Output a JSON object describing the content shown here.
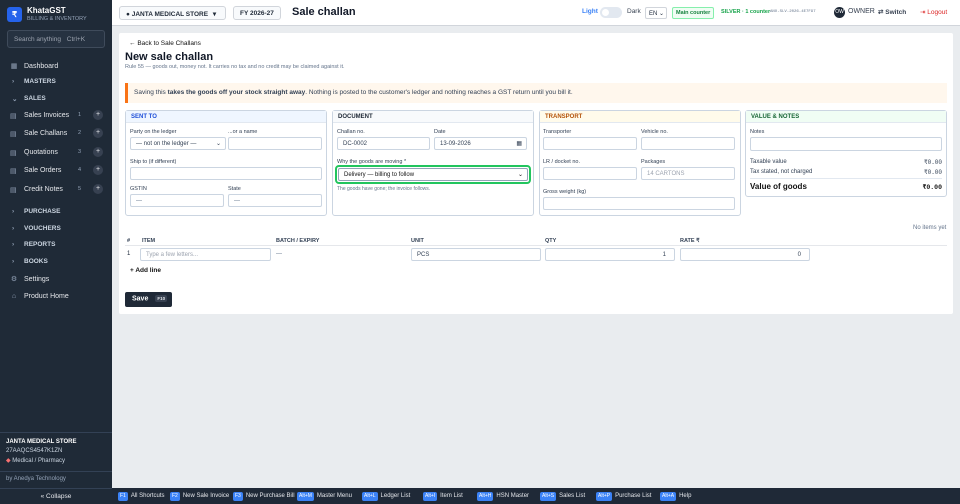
{
  "app": {
    "logo_glyph": "₹",
    "name": "KhataGST",
    "tagline": "BILLING & INVENTORY"
  },
  "search": {
    "label": "Search anything",
    "shortcut": "Ctrl+K"
  },
  "sidebar": {
    "dashboard": "Dashboard",
    "masters": "MASTERS",
    "sales": "SALES",
    "sales_items": [
      {
        "label": "Sales Invoices",
        "count": "1"
      },
      {
        "label": "Sale Challans",
        "count": "2"
      },
      {
        "label": "Quotations",
        "count": "3"
      },
      {
        "label": "Sale Orders",
        "count": "4"
      },
      {
        "label": "Credit Notes",
        "count": "5"
      }
    ],
    "purchase": "PURCHASE",
    "vouchers": "VOUCHERS",
    "reports": "REPORTS",
    "books": "BOOKS",
    "settings": "Settings",
    "product_home": "Product Home",
    "company_name": "JANTA MEDICAL STORE",
    "gstin": "27AAQCS4547K1ZN",
    "business_type": "Medical / Pharmacy",
    "by": "by Anedya Technology",
    "collapse": "« Collapse"
  },
  "topbar": {
    "company": "JANTA MEDICAL STORE",
    "fy": "FY 2026-27",
    "title": "Sale challan",
    "theme_light": "Light",
    "theme_dark": "Dark",
    "lang": "EN",
    "counter": "Main counter",
    "plan": "SILVER · 1 counter",
    "plan_code": "ANO-SLV-2026-4E7F97",
    "avatar": "OW",
    "role": "OWNER",
    "switch": "Switch",
    "logout": "Logout"
  },
  "page": {
    "back": "Back to Sale Challans",
    "title": "New sale challan",
    "lead": "Rule 55 — goods out, money not. It carries no tax and no credit may be claimed against it.",
    "alert_pre": "Saving this ",
    "alert_bold": "takes the goods off your stock straight away",
    "alert_post": ". Nothing is posted to the customer's ledger and nothing reaches a GST return until you bill it."
  },
  "sent_to": {
    "heading": "SENT TO",
    "party_label": "Party on the ledger",
    "party_value": "— not on the ledger —",
    "or_name_label": "...or a name",
    "ship_label": "Ship to (if different)",
    "gstin_label": "GSTIN",
    "gstin_value": "—",
    "state_label": "State",
    "state_value": "—"
  },
  "document": {
    "heading": "DOCUMENT",
    "challan_label": "Challan no.",
    "challan_value": "DC-0002",
    "date_label": "Date",
    "date_value": "13-09-2026",
    "why_label": "Why the goods are moving *",
    "why_value": "Delivery — billing to follow",
    "why_hint": "The goods have gone; the invoice follows."
  },
  "transport": {
    "heading": "TRANSPORT",
    "transporter_label": "Transporter",
    "vehicle_label": "Vehicle no.",
    "lr_label": "LR / docket no.",
    "packages_label": "Packages",
    "packages_placeholder": "14 CARTONS",
    "weight_label": "Gross weight (kg)"
  },
  "value_notes": {
    "heading": "VALUE & NOTES",
    "notes_label": "Notes",
    "taxable_label": "Taxable value",
    "taxable_value": "₹0.00",
    "tax_label": "Tax stated, not charged",
    "tax_value": "₹0.00",
    "total_label": "Value of goods",
    "total_value": "₹0.00"
  },
  "items": {
    "empty_text": "No items yet",
    "headers": [
      "#",
      "ITEM",
      "BATCH / EXPIRY",
      "UNIT",
      "QTY",
      "RATE ₹"
    ],
    "row": {
      "num": "1",
      "item_placeholder": "Type a few letters...",
      "batch": "—",
      "unit": "PCS",
      "qty": "1",
      "rate": "0"
    },
    "add_line": "+ Add line"
  },
  "save": {
    "label": "Save",
    "shortcut": "F10"
  },
  "footer": [
    {
      "key": "F1",
      "label": "All Shortcuts"
    },
    {
      "key": "F2",
      "label": "New Sale Invoice"
    },
    {
      "key": "F3",
      "label": "New Purchase Bill"
    },
    {
      "key": "Alt+M",
      "label": "Master Menu"
    },
    {
      "key": "Alt+L",
      "label": "Ledger List"
    },
    {
      "key": "Alt+I",
      "label": "Item List"
    },
    {
      "key": "Alt+H",
      "label": "HSN Master"
    },
    {
      "key": "Alt+S",
      "label": "Sales List"
    },
    {
      "key": "Alt+P",
      "label": "Purchase List"
    },
    {
      "key": "Alt+A",
      "label": "Help"
    }
  ],
  "colors": {
    "accent": "#2563eb",
    "sidebar_bg": "#1f2a37",
    "focus": "#16a34a",
    "alert": "#f97316",
    "transport": "#f59e0b"
  }
}
